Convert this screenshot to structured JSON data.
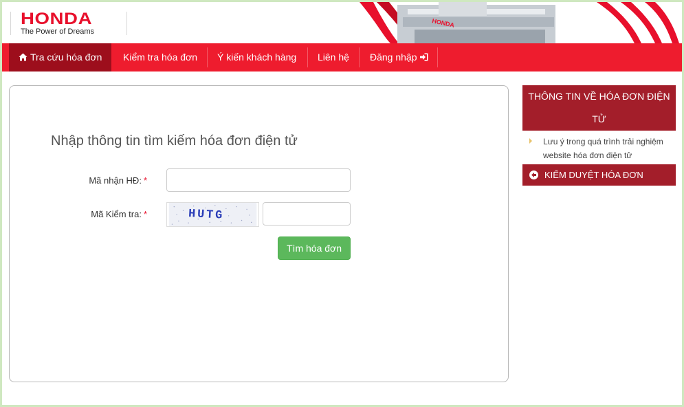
{
  "brand": {
    "name": "HONDA",
    "tagline": "The Power of Dreams",
    "color": "#e8102c"
  },
  "nav": {
    "items": [
      {
        "label": "Tra cứu hóa đơn",
        "icon": "home-icon",
        "active": true
      },
      {
        "label": "Kiểm tra hóa đơn"
      },
      {
        "label": "Ý kiến khách hàng"
      },
      {
        "label": "Liên hệ"
      },
      {
        "label": "Đăng nhập",
        "icon": "sign-in-icon"
      }
    ],
    "bg": "#ee1c2e",
    "active_bg": "#9d0e1c"
  },
  "form": {
    "title": "Nhập thông tin tìm kiếm hóa đơn điện tử",
    "invoice_code_label": "Mã nhận HĐ:",
    "check_code_label": "Mã Kiểm tra:",
    "required_mark": "*",
    "invoice_code_value": "",
    "check_code_value": "",
    "captcha_text": "HUTG",
    "submit_label": "Tìm hóa đơn"
  },
  "sidebar": {
    "heading": "THÔNG TIN VỀ HÓA ĐƠN ĐIỆN TỬ",
    "items": [
      {
        "label": "Lưu ý trong quá trình trải nghiệm website hóa đơn điện tử"
      }
    ],
    "review_button": "KIỂM DUYỆT HÓA ĐƠN",
    "accent": "#a31e2a"
  }
}
